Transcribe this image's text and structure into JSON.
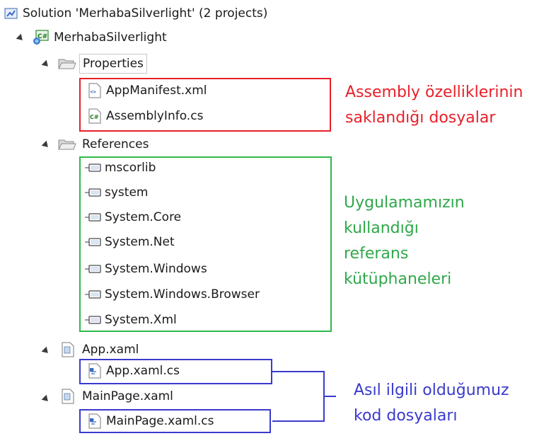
{
  "tree": {
    "solution": {
      "label": "Solution 'MerhabaSilverlight' (2 projects)"
    },
    "project": {
      "label": "MerhabaSilverlight"
    },
    "properties": {
      "label": "Properties",
      "items": [
        {
          "label": "AppManifest.xml",
          "icon": "xml-file-icon"
        },
        {
          "label": "AssemblyInfo.cs",
          "icon": "csharp-file-icon"
        }
      ]
    },
    "references": {
      "label": "References",
      "items": [
        {
          "label": "mscorlib"
        },
        {
          "label": "system"
        },
        {
          "label": "System.Core"
        },
        {
          "label": "System.Net"
        },
        {
          "label": "System.Windows"
        },
        {
          "label": "System.Windows.Browser"
        },
        {
          "label": "System.Xml"
        }
      ]
    },
    "app": {
      "label": "App.xaml",
      "child": "App.xaml.cs"
    },
    "mainpage": {
      "label": "MainPage.xaml",
      "child": "MainPage.xaml.cs"
    }
  },
  "annotations": {
    "properties_note": [
      "Assembly özelliklerinin",
      "saklandığı dosyalar"
    ],
    "references_note": [
      "Uygulamamızın",
      "kullandığı",
      "referans",
      "kütüphaneleri"
    ],
    "code_note": [
      "Asıl ilgili olduğumuz",
      "kod dosyaları"
    ]
  },
  "colors": {
    "properties_box": "#e8202a",
    "references_box": "#2fb84a",
    "code_box": "#3a3acd",
    "properties_text": "#e8202a",
    "references_text": "#2fa84a",
    "code_text": "#3a3acd"
  }
}
